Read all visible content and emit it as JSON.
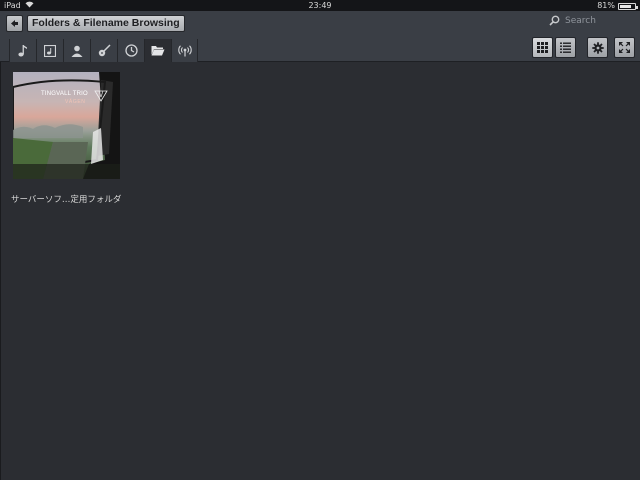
{
  "statusbar": {
    "device": "iPad",
    "time": "23:49",
    "battery_text": "81%",
    "battery_level": 0.81
  },
  "toolbar": {
    "back_icon": "arrow-left-icon",
    "title": "Folders & Filename Browsing",
    "search_placeholder": "Search",
    "tabs": [
      {
        "icon": "music-note-icon",
        "active": false
      },
      {
        "icon": "album-icon",
        "active": false
      },
      {
        "icon": "artist-icon",
        "active": false
      },
      {
        "icon": "guitar-icon",
        "active": false
      },
      {
        "icon": "clock-icon",
        "active": false
      },
      {
        "icon": "folder-icon",
        "active": true
      },
      {
        "icon": "radio-icon",
        "active": false
      }
    ],
    "view_buttons": [
      {
        "icon": "grid-view-icon",
        "active": true
      },
      {
        "icon": "list-view-icon",
        "active": false
      },
      {
        "icon": "settings-gear-icon",
        "active": false
      },
      {
        "icon": "fullscreen-icon",
        "active": false
      }
    ]
  },
  "content": {
    "items": [
      {
        "label": "サーバーソフ…定用フォルダ",
        "cover_title": "TINGVALL TRIO",
        "cover_subtitle": "VÄGEN"
      }
    ]
  },
  "colors": {
    "background": "#2b2d32",
    "toolbar": "#3a3e45",
    "status_bar": "#141518",
    "button_light": "#c7c9cc"
  }
}
